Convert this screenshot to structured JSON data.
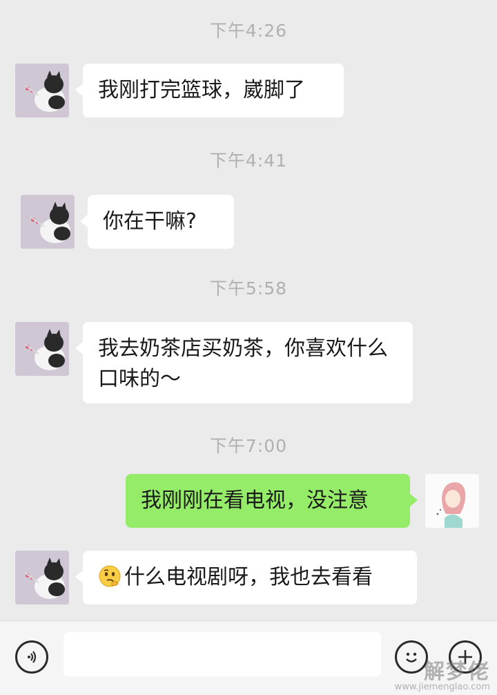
{
  "messages": [
    {
      "time": "下午4:26",
      "from": "other",
      "text": "我刚打完篮球，崴脚了"
    },
    {
      "time": "下午4:41",
      "from": "other",
      "text": "你在干嘛?"
    },
    {
      "time": "下午5:58",
      "from": "other",
      "text": "我去奶茶店买奶茶，你喜欢什么口味的～"
    },
    {
      "time": "下午7:00",
      "from": "me",
      "text": "我刚刚在看电视，没注意"
    },
    {
      "from": "other",
      "emoji": "thinking-face-emoji",
      "text": "什么电视剧呀，我也去看看"
    }
  ],
  "input_bar": {
    "voice_icon": "voice-icon",
    "input_value": "",
    "emoji_icon": "smiley-icon",
    "more_icon": "plus-icon"
  },
  "watermark": {
    "title": "解梦佬",
    "url": "www.jiemenglao.com"
  },
  "colors": {
    "background": "#ebebeb",
    "other_bubble": "#ffffff",
    "my_bubble": "#95ec69",
    "timestamp": "#b0b0b0"
  }
}
